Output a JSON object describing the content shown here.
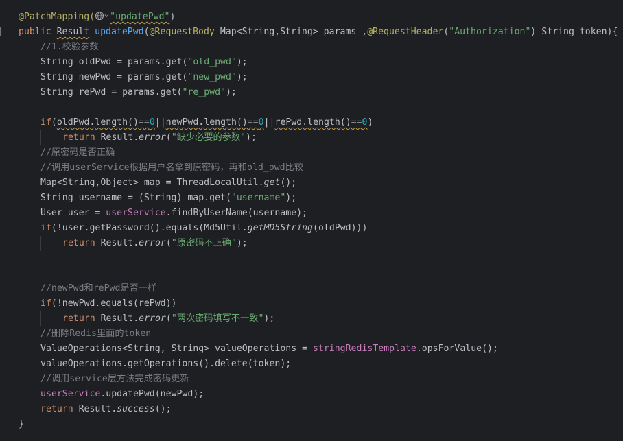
{
  "colors": {
    "background": "#1e1f22",
    "default_text": "#bcbec4",
    "keyword": "#cf8e6d",
    "string": "#6aab73",
    "number": "#2aacb8",
    "comment": "#7a7e85",
    "annotation": "#b3ae60",
    "field": "#c77dbb",
    "method_decl": "#56a8f5",
    "warning_underline": "#c7a34d"
  },
  "icons": {
    "mapping_icon": "globe-icon",
    "mapping_dropdown": "chevron-down-icon"
  },
  "code": {
    "l01": {
      "a1": "@PatchMapping(",
      "s1": "\"updatePwd\"",
      "p1": ")"
    },
    "l02": {
      "k1": "public ",
      "t1": "Result",
      "p1": " ",
      "m1": "updatePwd",
      "p2": "(",
      "a1": "@RequestBody",
      "p3": " Map<String,String> params ,",
      "a2": "@RequestHeader",
      "p4": "(",
      "s1": "\"Authorization\"",
      "p5": ") String token){"
    },
    "l03": {
      "c1": "//1.校验参数"
    },
    "l04": {
      "p1": "String oldPwd = params.get(",
      "s1": "\"old_pwd\"",
      "p2": ");"
    },
    "l05": {
      "p1": "String newPwd = params.get(",
      "s1": "\"new_pwd\"",
      "p2": ");"
    },
    "l06": {
      "p1": "String rePwd = params.get(",
      "s1": "\"re_pwd\"",
      "p2": ");"
    },
    "l08": {
      "k1": "if",
      "p1": "(",
      "w1": "oldPwd.length()==",
      "n1": "0",
      "p2": "||",
      "w2": "newPwd.length()==",
      "n2": "0",
      "p3": "||",
      "w3": "rePwd.length()==",
      "n3": "0",
      "p4": ")"
    },
    "l09": {
      "k1": "return ",
      "p1": "Result.",
      "i1": "error",
      "p2": "(",
      "s1": "\"缺少必要的参数\"",
      "p3": ");"
    },
    "l10": {
      "c1": "//原密码是否正确"
    },
    "l11": {
      "c1": "//调用userService根据用户名拿到原密码，再和old_pwd比较"
    },
    "l12": {
      "p1": "Map<String,Object> map = ThreadLocalUtil.",
      "i1": "get",
      "p2": "();"
    },
    "l13": {
      "p1": "String username = (String) map.get(",
      "s1": "\"username\"",
      "p2": ");"
    },
    "l14": {
      "p1": "User user = ",
      "f1": "userService",
      "p2": ".findByUserName(username);"
    },
    "l15": {
      "k1": "if",
      "p1": "(!user.getPassword().equals(Md5Util.",
      "i1": "getMD5String",
      "p2": "(oldPwd)))"
    },
    "l16": {
      "k1": "return ",
      "p1": "Result.",
      "i1": "error",
      "p2": "(",
      "s1": "\"原密码不正确\"",
      "p3": ");"
    },
    "l19": {
      "c1": "//newPwd和rePwd是否一样"
    },
    "l20": {
      "k1": "if",
      "p1": "(!newPwd.equals(rePwd))"
    },
    "l21": {
      "k1": "return ",
      "p1": "Result.",
      "i1": "error",
      "p2": "(",
      "s1": "\"两次密码填写不一致\"",
      "p3": ");"
    },
    "l22": {
      "c1": "//删除Redis里面的token"
    },
    "l23": {
      "p1": "ValueOperations<String, String> valueOperations = ",
      "f1": "stringRedisTemplate",
      "p2": ".opsForValue();"
    },
    "l24": {
      "p1": "valueOperations.getOperations().delete(token);"
    },
    "l25": {
      "c1": "//调用service层方法完成密码更新"
    },
    "l26": {
      "f1": "userService",
      "p1": ".updatePwd(newPwd);"
    },
    "l27": {
      "k1": "return ",
      "p1": "Result.",
      "i1": "success",
      "p2": "();"
    },
    "l28": {
      "p1": "}"
    }
  }
}
